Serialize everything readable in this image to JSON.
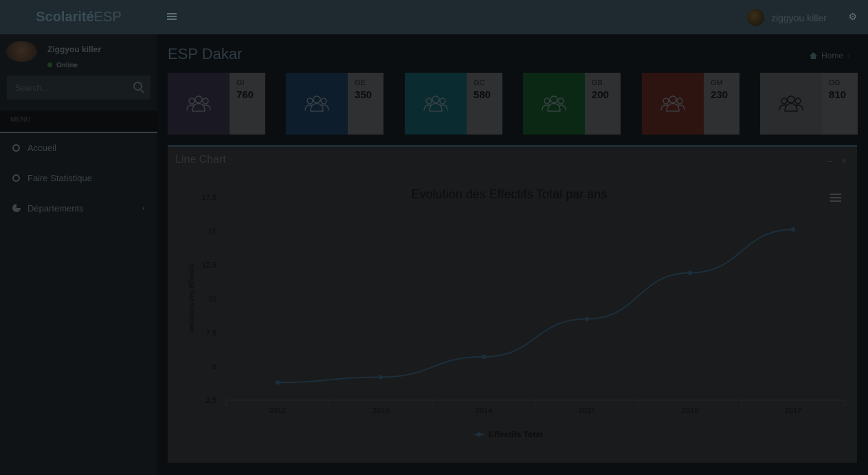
{
  "brand": {
    "bold": "Scolarité",
    "light": "ESP"
  },
  "header": {
    "user_name": "ziggyou killer"
  },
  "sidebar": {
    "user": {
      "name": "Ziggyou killer",
      "status": "Online"
    },
    "search_placeholder": "Search...",
    "section_label": "MENU",
    "items": [
      {
        "label": "Accueil",
        "icon": "circle-icon"
      },
      {
        "label": "Faire Statistique",
        "icon": "circle-icon"
      },
      {
        "label": "Départements",
        "icon": "pie-chart-icon"
      }
    ]
  },
  "page": {
    "title": "ESP Dakar",
    "subtitle": "",
    "breadcrumb": {
      "home": "Home",
      "active": ""
    }
  },
  "stats": [
    {
      "code": "GI",
      "value": "760",
      "color": "#1a1822"
    },
    {
      "code": "GE",
      "value": "350",
      "color": "#0d1d2b"
    },
    {
      "code": "GC",
      "value": "580",
      "color": "#0a2b30"
    },
    {
      "code": "GB",
      "value": "200",
      "color": "#0b2815"
    },
    {
      "code": "GM",
      "value": "230",
      "color": "#2d1410"
    },
    {
      "code": "DG",
      "value": "810",
      "color": "#2b2c2d"
    }
  ],
  "chart_panel": {
    "title": "Line Chart"
  },
  "chart_data": {
    "type": "line",
    "title": "Evolution des Effectifs Total par ans",
    "xlabel": "",
    "ylabel": "Variations des Effectifs",
    "categories": [
      "2012",
      "2013",
      "2014",
      "2015",
      "2016",
      "2017"
    ],
    "series": [
      {
        "name": "Effectifs Total",
        "values": [
          3.8,
          4.2,
          5.7,
          8.5,
          11.9,
          15.1
        ]
      }
    ],
    "yticks": [
      2.5,
      5,
      7.5,
      10,
      12.5,
      15,
      17.5
    ],
    "ylim": [
      2.5,
      17.5
    ],
    "legend": "bottom-center",
    "line_color": "#1c2f3d"
  }
}
